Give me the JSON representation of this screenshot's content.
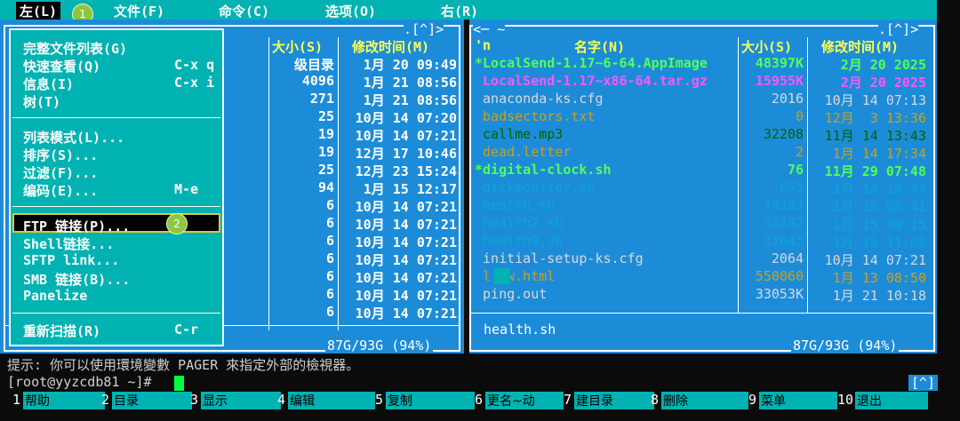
{
  "menubar": {
    "left": "左(L)",
    "file": "文件(F)",
    "command": "命令(C)",
    "options": "选项(O)",
    "right": "右(R)"
  },
  "badges": {
    "one": "1",
    "two": "2"
  },
  "left_panel": {
    "top_caret": ".[^]>",
    "col_size": "大小(S)",
    "col_mtime": "修改时间(M)",
    "rows": [
      {
        "size": "级目录",
        "date": "1月 20 09:49"
      },
      {
        "size": "4096",
        "date": "1月 21 08:56"
      },
      {
        "size": "271",
        "date": "1月 21 08:56"
      },
      {
        "size": "25",
        "date": "10月 14 07:20"
      },
      {
        "size": "19",
        "date": "10月 14 07:21"
      },
      {
        "size": "19",
        "date": "12月 17 10:46"
      },
      {
        "size": "25",
        "date": "12月 23 15:24"
      },
      {
        "size": "94",
        "date": "1月 15 12:17"
      },
      {
        "size": "6",
        "date": "10月 14 07:21"
      },
      {
        "size": "6",
        "date": "10月 14 07:21"
      },
      {
        "size": "6",
        "date": "10月 14 07:21"
      },
      {
        "size": "6",
        "date": "10月 14 07:21"
      },
      {
        "size": "6",
        "date": "10月 14 07:21"
      },
      {
        "size": "6",
        "date": "10月 14 07:21"
      },
      {
        "size": "6",
        "date": "10月 14 07:21"
      }
    ],
    "disk": "87G/93G (94%)"
  },
  "right_panel": {
    "top_left": "<─ ~",
    "top_caret": ".[^]>",
    "col_n": "'n",
    "col_name": "名字(N)",
    "col_size": "大小(S)",
    "col_mtime": "修改时间(M)",
    "rows": [
      {
        "name": "*LocalSend-1.17~6-64.AppImage",
        "size": "48397K",
        "date": "2月 20 2025",
        "color": "green"
      },
      {
        "name": " LocalSend-1.17~x86-64.tar.gz",
        "size": "15955K",
        "date": "2月 20 2025",
        "color": "magenta"
      },
      {
        "name": " anaconda-ks.cfg",
        "size": "2016",
        "date": "10月 14 07:13",
        "color": "gray"
      },
      {
        "name": " badsectors.txt",
        "size": "0",
        "date": "12月  3 13:36",
        "color": "brown"
      },
      {
        "name": " callme.mp3",
        "size": "32208",
        "date": "11月 14 13:43",
        "color": "dgreen"
      },
      {
        "name": " dead.letter",
        "size": "2",
        "date": "1月 14 17:34",
        "color": "brown"
      },
      {
        "name": "*digital-clock.sh",
        "size": "76",
        "date": "11月 29 07:48",
        "color": "green"
      },
      {
        "name": " diskmonitor.sh",
        "size": "605",
        "date": "1月 14 10:44",
        "color": "dcyan"
      },
      {
        "name": " health.sh",
        "size": "14383",
        "date": "1月 15 08:41",
        "color": "dcyan"
      },
      {
        "name": " health2.sh",
        "size": "33392",
        "date": "1月 15 09:15",
        "color": "dcyan"
      },
      {
        "name": " health9.sh",
        "size": "31643",
        "date": "1月 15 11:06",
        "color": "dcyan"
      },
      {
        "name": " initial-setup-ks.cfg",
        "size": "2064",
        "date": "10月 14 07:21",
        "color": "gray"
      },
      {
        "name": " l  w.html",
        "size": "550060",
        "date": "1月 13 08:50",
        "color": "brown"
      },
      {
        "name": " ping.out",
        "size": "33053K",
        "date": "1月 21 10:18",
        "color": "gray"
      }
    ],
    "current_file": "health.sh",
    "disk": "87G/93G (94%)"
  },
  "left_menu": {
    "items": [
      {
        "label": "完整文件列表(G)",
        "shortcut": ""
      },
      {
        "label": "快速查看(Q)",
        "shortcut": "C-x q"
      },
      {
        "label": "信息(I)",
        "shortcut": "C-x i"
      },
      {
        "label": "树(T)",
        "shortcut": ""
      },
      {
        "label": "列表模式(L)...",
        "shortcut": ""
      },
      {
        "label": "排序(S)...",
        "shortcut": ""
      },
      {
        "label": "过滤(F)...",
        "shortcut": ""
      },
      {
        "label": "编码(E)...",
        "shortcut": "M-e"
      },
      {
        "label": "FTP 链接(P)...",
        "shortcut": ""
      },
      {
        "label": "Shell链接...",
        "shortcut": ""
      },
      {
        "label": "SFTP link...",
        "shortcut": ""
      },
      {
        "label": "SMB 链接(B)...",
        "shortcut": ""
      },
      {
        "label": "Panelize",
        "shortcut": ""
      },
      {
        "label": "重新扫描(R)",
        "shortcut": "C-r"
      }
    ]
  },
  "hint": "提示: 你可以使用環境變數 PAGER 來指定外部的檢視器。",
  "prompt": "[root@yyzcdb81 ~]#",
  "prompt_caret": "[^]",
  "fkeys": [
    {
      "num": "1",
      "label": "帮助"
    },
    {
      "num": "2",
      "label": "目录"
    },
    {
      "num": "3",
      "label": "显示"
    },
    {
      "num": "4",
      "label": "编辑"
    },
    {
      "num": "5",
      "label": "复制"
    },
    {
      "num": "6",
      "label": "更名~动"
    },
    {
      "num": "7",
      "label": "建目录"
    },
    {
      "num": "8",
      "label": "删除"
    },
    {
      "num": "9",
      "label": "菜单"
    },
    {
      "num": "10",
      "label": "退出"
    }
  ]
}
